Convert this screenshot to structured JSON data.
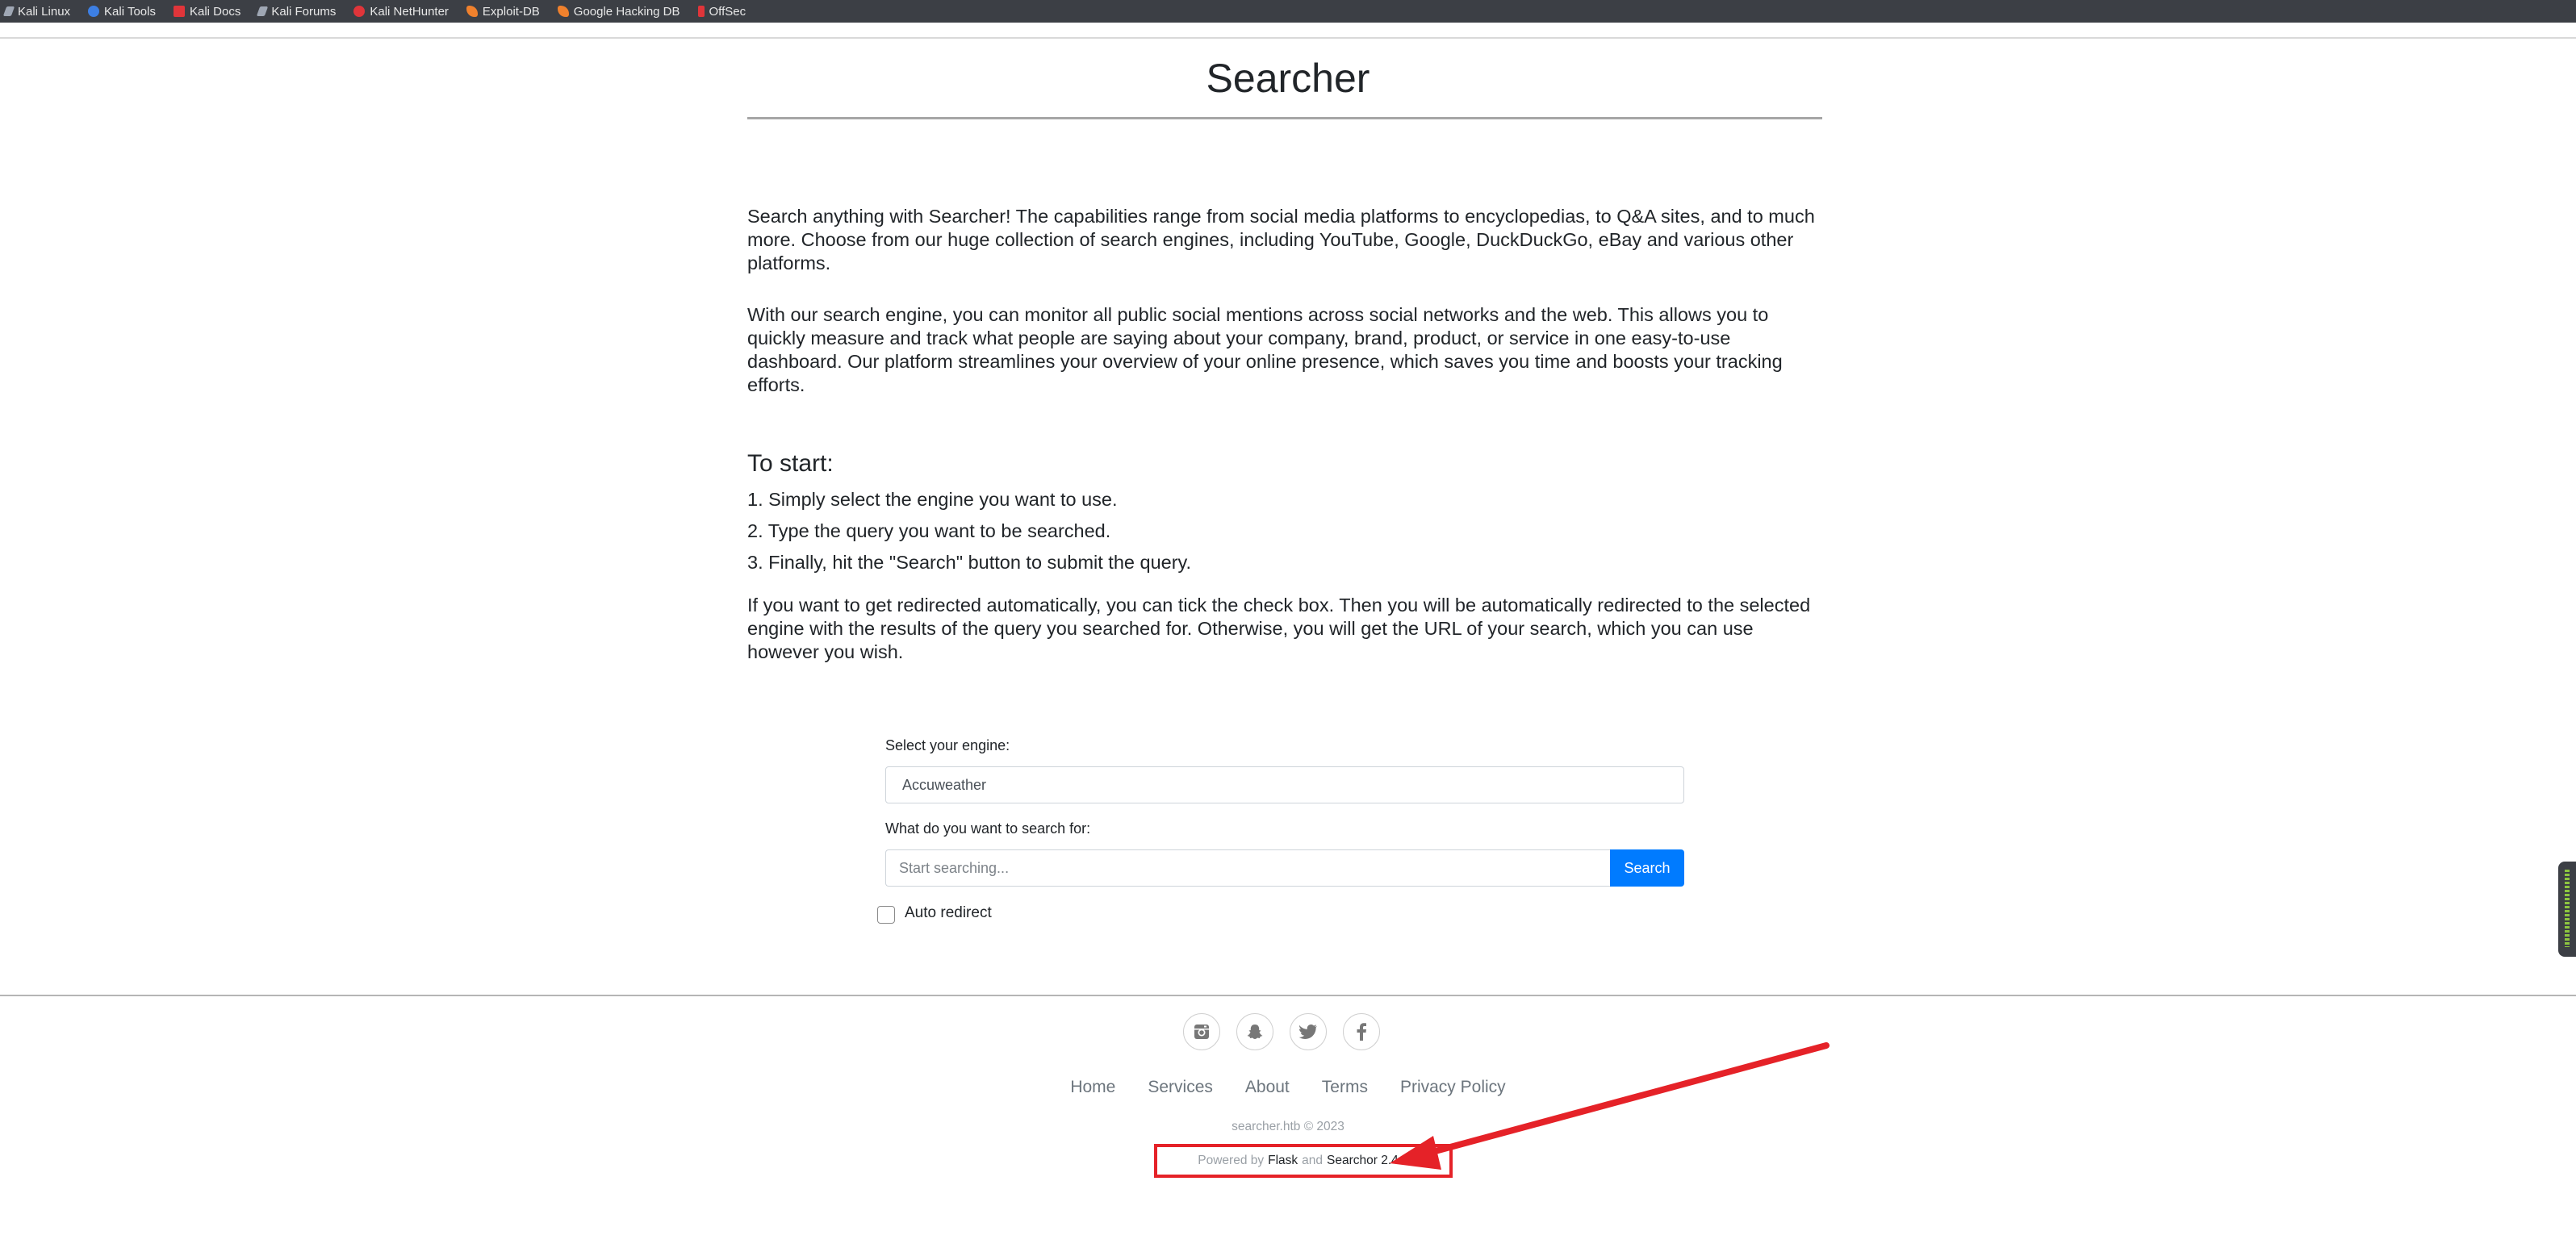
{
  "bookmarks": [
    {
      "label": "Kali Linux",
      "icon": "kali-dragon-icon",
      "color": "#9fa7b4"
    },
    {
      "label": "Kali Tools",
      "icon": "kali-tools-icon",
      "color": "#3d7fe3"
    },
    {
      "label": "Kali Docs",
      "icon": "kali-docs-icon",
      "color": "#e0353a"
    },
    {
      "label": "Kali Forums",
      "icon": "kali-forums-icon",
      "color": "#9fa7b4"
    },
    {
      "label": "Kali NetHunter",
      "icon": "nethunter-icon",
      "color": "#e0353a"
    },
    {
      "label": "Exploit-DB",
      "icon": "exploit-db-icon",
      "color": "#f0812d"
    },
    {
      "label": "Google Hacking DB",
      "icon": "ghdb-icon",
      "color": "#f0812d"
    },
    {
      "label": "OffSec",
      "icon": "offsec-icon",
      "color": "#e0353a"
    }
  ],
  "page": {
    "title": "Searcher",
    "intro_1": "Search anything with Searcher! The capabilities range from social media platforms to encyclopedias, to Q&A sites, and to much more. Choose from our huge collection of search engines, including YouTube, Google, DuckDuckGo, eBay and various other platforms.",
    "intro_2": "With our search engine, you can monitor all public social mentions across social networks and the web. This allows you to quickly measure and track what people are saying about your company, brand, product, or service in one easy-to-use dashboard. Our platform streamlines your overview of your online presence, which saves you time and boosts your tracking efforts.",
    "start_heading": "To start:",
    "steps": [
      "1. Simply select the engine you want to use.",
      "2. Type the query you want to be searched.",
      "3. Finally, hit the \"Search\" button to submit the query."
    ],
    "redirect_note": "If you want to get redirected automatically, you can tick the check box. Then you will be automatically redirected to the selected engine with the results of the query you searched for. Otherwise, you will get the URL of your search, which you can use however you wish."
  },
  "form": {
    "engine_label": "Select your engine:",
    "engine_value": "Accuweather",
    "query_label": "What do you want to search for:",
    "query_placeholder": "Start searching...",
    "query_value": "",
    "search_button": "Search",
    "auto_redirect_label": "Auto redirect",
    "auto_redirect_checked": false
  },
  "footer": {
    "social": [
      {
        "name": "instagram-icon"
      },
      {
        "name": "snapchat-icon"
      },
      {
        "name": "twitter-icon"
      },
      {
        "name": "facebook-icon"
      }
    ],
    "links": [
      "Home",
      "Services",
      "About",
      "Terms",
      "Privacy Policy"
    ],
    "copyright": "searcher.htb © 2023",
    "powered_prefix": "Powered by",
    "powered_flask": "Flask",
    "powered_and": "and",
    "powered_searchor": "Searchor 2.4.0"
  },
  "annotation": {
    "color": "#e52228"
  },
  "colors": {
    "button": "#007bff",
    "bookmarks_bar": "#3c3f45"
  }
}
